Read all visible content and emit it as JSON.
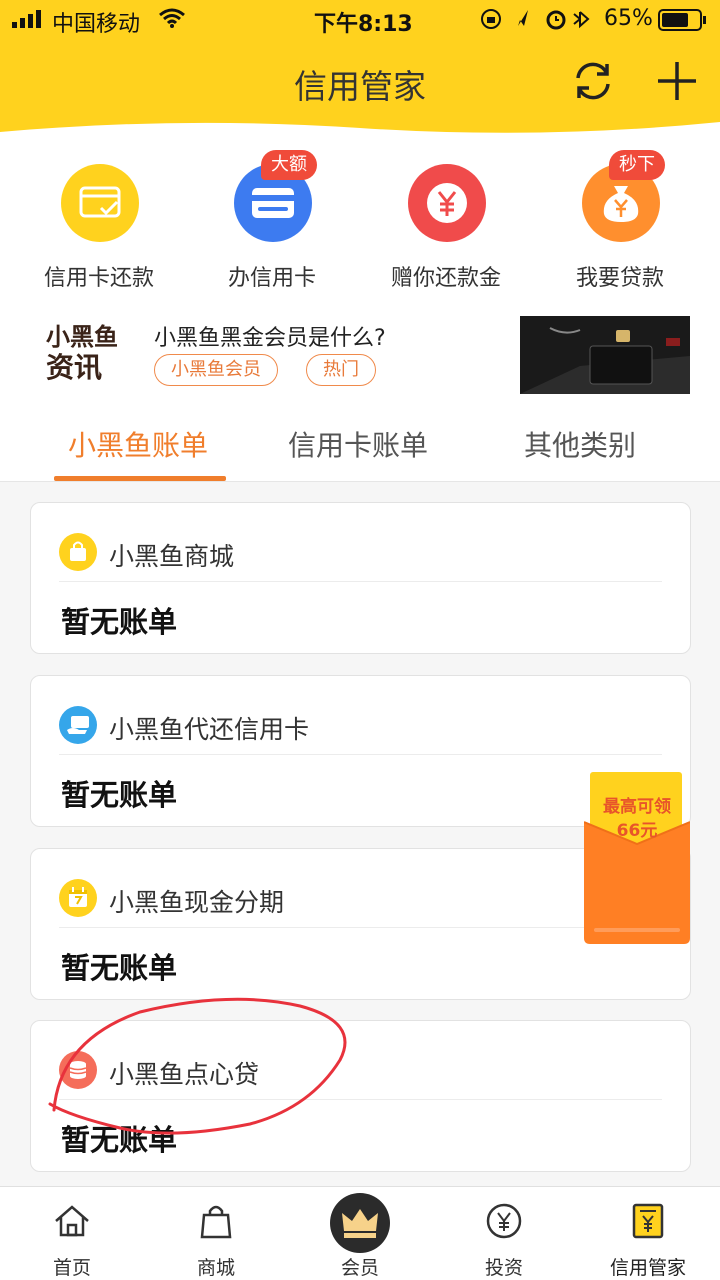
{
  "status_bar": {
    "carrier": "中国移动",
    "time": "下午8:13",
    "battery": "65%"
  },
  "header": {
    "title": "信用管家",
    "refresh_icon": "refresh-icon",
    "add_icon": "plus-icon",
    "accent": "#ffd21e"
  },
  "quick_actions": [
    {
      "label": "信用卡还款",
      "icon": "card-check-icon",
      "color": "#ffd21e"
    },
    {
      "label": "办信用卡",
      "icon": "credit-card-icon",
      "color": "#3d7bf0",
      "badge": "大额"
    },
    {
      "label": "赠你还款金",
      "icon": "yen-coin-icon",
      "color": "#f04b4b"
    },
    {
      "label": "我要贷款",
      "icon": "money-bag-icon",
      "color": "#ff8f2e",
      "badge": "秒下"
    }
  ],
  "news": {
    "logo_line1": "小黑鱼",
    "logo_line2": "资讯",
    "title": "小黑鱼黑金会员是什么?",
    "tags": [
      "小黑鱼会员",
      "热门"
    ]
  },
  "tabs": [
    {
      "label": "小黑鱼账单",
      "active": true
    },
    {
      "label": "信用卡账单",
      "active": false
    },
    {
      "label": "其他类别",
      "active": false
    }
  ],
  "bills": [
    {
      "title": "小黑鱼商城",
      "status": "暂无账单",
      "icon": "shopping-bag-icon",
      "color": "#ffd21e"
    },
    {
      "title": "小黑鱼代还信用卡",
      "status": "暂无账单",
      "icon": "card-hand-icon",
      "color": "#35a6ea"
    },
    {
      "title": "小黑鱼现金分期",
      "status": "暂无账单",
      "icon": "calendar-icon",
      "color": "#ffd21e"
    },
    {
      "title": "小黑鱼点心贷",
      "status": "暂无账单",
      "icon": "coin-stack-icon",
      "color": "#f56d5a"
    }
  ],
  "red_packet": {
    "line1": "最高可领",
    "line2": "66元"
  },
  "bottom_nav": [
    {
      "label": "首页",
      "icon": "home-icon"
    },
    {
      "label": "商城",
      "icon": "shopping-bag-icon"
    },
    {
      "label": "会员",
      "icon": "crown-icon"
    },
    {
      "label": "投资",
      "icon": "yen-circle-icon"
    },
    {
      "label": "信用管家",
      "icon": "ledger-icon",
      "active": true
    }
  ]
}
